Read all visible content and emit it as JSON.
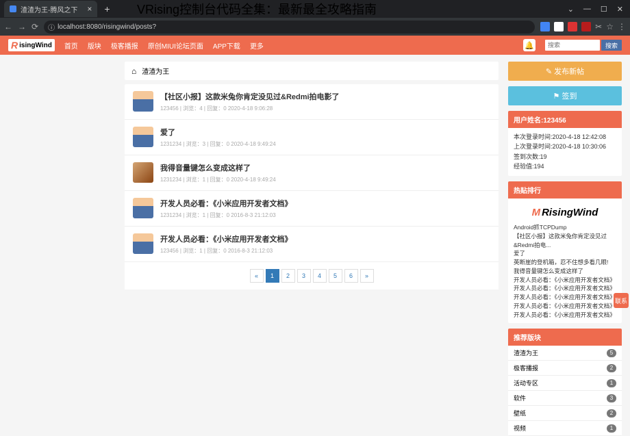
{
  "overlay_title": "VRising控制台代码全集：最新最全攻略指南",
  "browser": {
    "tab_title": "渣渣为王-腾风之下",
    "url_text": "localhost:8080/risingwind/posts?",
    "win_min": "—",
    "win_max": "☐",
    "win_close": "✕"
  },
  "nav": {
    "logo_text": "isingWind",
    "items": [
      "首页",
      "版块",
      "极客播报",
      "原创MIUI论坛页面",
      "APP下载",
      "更多"
    ],
    "search_placeholder": "搜索",
    "search_btn": "搜索"
  },
  "crumb": {
    "section": "渣渣为王"
  },
  "posts": [
    {
      "title": "【社区小报】这款米兔你肯定没见过&Redmi拍电影了",
      "meta": "123456 | 浏览：4 | 回复：0   2020-4-18 9:06:28",
      "av": "n"
    },
    {
      "title": "爱了",
      "meta": "1231234 | 浏览：3 | 回复：0   2020-4-18 9:49:24",
      "av": "n"
    },
    {
      "title": "我得音量键怎么变成这样了",
      "meta": "1231234 | 浏览：1 | 回复：0   2020-4-18 9:49:24",
      "av": "d"
    },
    {
      "title": "开发人员必看：《小米应用开发者文档》",
      "meta": "1231234 | 浏览：1 | 回复：0   2016-8-3 21:12:03",
      "av": "n"
    },
    {
      "title": "开发人员必看：《小米应用开发者文档》",
      "meta": "123456 | 浏览：1 | 回复：0   2016-8-3 21:12:03",
      "av": "n"
    }
  ],
  "pager": {
    "prev": "«",
    "pages": [
      "1",
      "2",
      "3",
      "4",
      "5",
      "6"
    ],
    "next": "»",
    "active": "1"
  },
  "side": {
    "new_post": "✎ 发布新帖",
    "signin": "⚑ 签到",
    "user_hdr": "用户姓名:123456",
    "user_lines": [
      "本次登录时间:2020-4-18 12:42:08",
      "上次登录时间:2020-4-18 10:30:06",
      "签到次数:19",
      "经验值:194"
    ],
    "hot_hdr": "热贴排行",
    "hot_logo": "RisingWind",
    "hot_items": [
      "Android抓TCPDump",
      "【社区小报】这款米兔你肯定没见过&Redmi拍电...",
      "爱了",
      "英断崖的登机箱，忍不住想多看几眼!",
      "我得音量键怎么变成这样了",
      "开发人员必看：《小米应用开发者文档》",
      "开发人员必看：《小米应用开发者文档》",
      "开发人员必看：《小米应用开发者文档》",
      "开发人员必看：《小米应用开发者文档》",
      "开发人员必看：《小米应用开发者文档》"
    ],
    "rec_hdr": "推荐版块",
    "rec_items": [
      {
        "n": "渣渣为王",
        "c": "5"
      },
      {
        "n": "极客播报",
        "c": "2"
      },
      {
        "n": "活动专区",
        "c": "1"
      },
      {
        "n": "软件",
        "c": "3"
      },
      {
        "n": "壁纸",
        "c": "2"
      },
      {
        "n": "视频",
        "c": "1"
      }
    ]
  },
  "float": "联系"
}
